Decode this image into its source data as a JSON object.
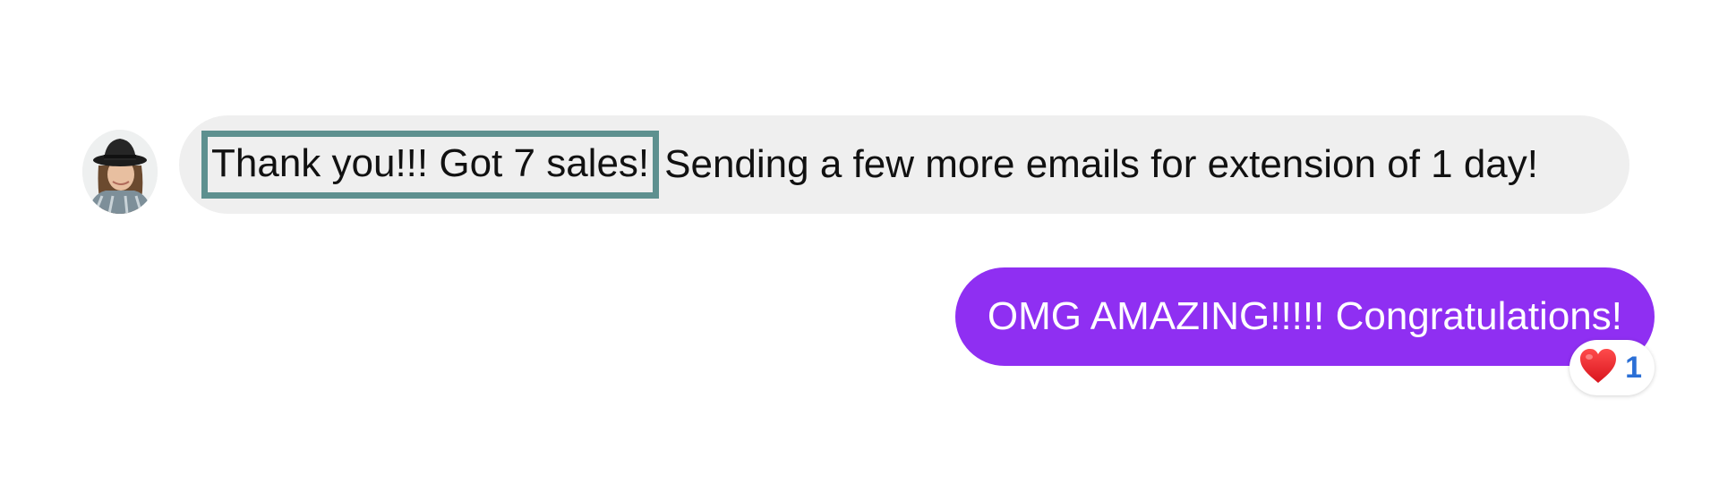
{
  "incoming_message": {
    "highlighted_text": "Thank you!!! Got 7 sales!",
    "rest_text": "Sending a few more emails for extension of 1 day!"
  },
  "outgoing_message": {
    "text": "OMG AMAZING!!!!! Congratulations!"
  },
  "reaction": {
    "icon": "heart-icon",
    "count": "1"
  },
  "colors": {
    "incoming_bubble": "#efefef",
    "outgoing_bubble": "#8f2ff2",
    "highlight_border": "#5e908f",
    "reaction_count": "#2b6fd6"
  }
}
